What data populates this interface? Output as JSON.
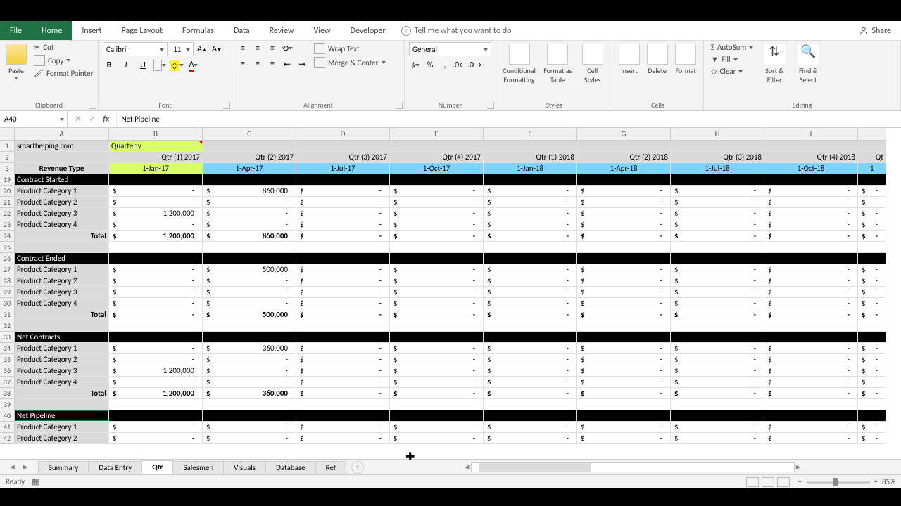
{
  "tabs": {
    "file": "File",
    "home": "Home",
    "insert": "Insert",
    "pagelayout": "Page Layout",
    "formulas": "Formulas",
    "data": "Data",
    "review": "Review",
    "view": "View",
    "developer": "Developer",
    "tell": "Tell me what you want to do",
    "share": "Share"
  },
  "ribbon": {
    "clipboard": {
      "paste": "Paste",
      "cut": "Cut",
      "copy": "Copy",
      "fmtpainter": "Format Painter",
      "label": "Clipboard"
    },
    "font": {
      "name": "Calibri",
      "size": "11",
      "bold": "B",
      "italic": "I",
      "underline": "U",
      "label": "Font"
    },
    "align": {
      "wrap": "Wrap Text",
      "merge": "Merge & Center",
      "label": "Alignment"
    },
    "number": {
      "general": "General",
      "dollar": "$",
      "pct": "%",
      "comma": ",",
      "inc": "",
      "dec": "",
      "label": "Number"
    },
    "styles": {
      "cond": "Conditional Formatting",
      "fmtas": "Format as Table",
      "cell": "Cell Styles",
      "label": "Styles"
    },
    "cells": {
      "insert": "Insert",
      "delete": "Delete",
      "format": "Format",
      "label": "Cells"
    },
    "editing": {
      "autosum": "AutoSum",
      "fill": "Fill",
      "clear": "Clear",
      "sort": "Sort & Filter",
      "find": "Find & Select",
      "label": "Editing"
    }
  },
  "namebox": "A40",
  "formula": "Net Pipeline",
  "cols": [
    "",
    "A",
    "B",
    "C",
    "D",
    "E",
    "F",
    "G",
    "H",
    "I"
  ],
  "r1": {
    "a": "smarthelping.com",
    "b": "Quarterly"
  },
  "r2": [
    "Qtr (1) 2017",
    "Qtr (2) 2017",
    "Qtr (3) 2017",
    "Qtr (4) 2017",
    "Qtr (1) 2018",
    "Qtr (2) 2018",
    "Qtr (3) 2018",
    "Qtr (4) 2018",
    "Qt"
  ],
  "r3": {
    "a": "Revenue Type",
    "d": [
      "1-Jan-17",
      "1-Apr-17",
      "1-Jul-17",
      "1-Oct-17",
      "1-Jan-18",
      "1-Apr-18",
      "1-Jul-18",
      "1-Oct-18",
      "1"
    ]
  },
  "sections": {
    "contract_started": "Contract Started",
    "contract_ended": "Contract Ended",
    "net_contracts": "Net Contracts",
    "net_pipeline": "Net Pipeline"
  },
  "cats": [
    "Product Category 1",
    "Product Category 2",
    "Product Category 3",
    "Product Category 4"
  ],
  "total": "Total",
  "vals": {
    "cs": {
      "pc1_c": "860,000",
      "pc3_b": "1,200,000",
      "tot_b": "1,200,000",
      "tot_c": "860,000"
    },
    "ce": {
      "pc1_c": "500,000",
      "tot_c": "500,000"
    },
    "nc": {
      "pc1_c": "360,000",
      "pc3_b": "1,200,000",
      "tot_b": "1,200,000",
      "tot_c": "360,000"
    }
  },
  "sheets": [
    "Summary",
    "Data Entry",
    "Qtr",
    "Salesmen",
    "Visuals",
    "Database",
    "Ref"
  ],
  "active_sheet": 2,
  "status": {
    "ready": "Ready",
    "zoom": "85%"
  },
  "rownums": [
    "1",
    "2",
    "3",
    "19",
    "20",
    "21",
    "22",
    "23",
    "24",
    "25",
    "26",
    "27",
    "28",
    "29",
    "30",
    "31",
    "32",
    "33",
    "34",
    "35",
    "36",
    "37",
    "38",
    "39",
    "40",
    "41",
    "42"
  ]
}
